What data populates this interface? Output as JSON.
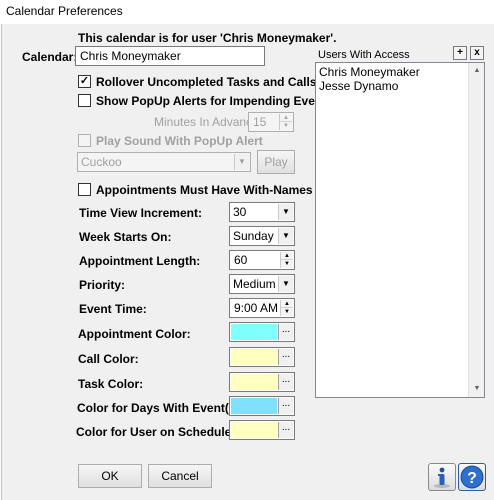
{
  "window": {
    "title": "Calendar Preferences"
  },
  "header": {
    "user_text": "This calendar is for user 'Chris Moneymaker'."
  },
  "calendar": {
    "label": "Calendar:",
    "value": "Chris Moneymaker"
  },
  "options": {
    "rollover": {
      "label": "Rollover Uncompleted Tasks and Calls",
      "checked": true
    },
    "popup": {
      "label": "Show PopUp Alerts for Impending Events",
      "checked": false
    },
    "minutes": {
      "label": "Minutes In Advance:",
      "value": "15"
    },
    "sound": {
      "label": "Play Sound With PopUp Alert",
      "checked": false
    },
    "sound_select": {
      "value": "Cuckoo"
    },
    "play_label": "Play",
    "with_names": {
      "label": "Appointments Must Have With-Names",
      "checked": false
    }
  },
  "settings": {
    "time_view": {
      "label": "Time View Increment:",
      "value": "30"
    },
    "week_start": {
      "label": "Week Starts On:",
      "value": "Sunday"
    },
    "appt_length": {
      "label": "Appointment Length:",
      "value": "60"
    },
    "priority": {
      "label": "Priority:",
      "value": "Medium"
    },
    "event_time": {
      "label": "Event Time:",
      "value": "9:00 AM"
    }
  },
  "colors": {
    "appointment": {
      "label": "Appointment Color:",
      "color": "#80ffff"
    },
    "call": {
      "label": "Call Color:",
      "color": "#ffffc0"
    },
    "task": {
      "label": "Task Color:",
      "color": "#ffffc0"
    },
    "days_event": {
      "label": "Color for Days With Event(s):",
      "color": "#80e0ff"
    },
    "user_sched": {
      "label": "Color for User on Scheduler:",
      "color": "#ffffc0"
    }
  },
  "access": {
    "header": "Users With Access",
    "add": "+",
    "remove": "x",
    "users": [
      "Chris Moneymaker",
      "Jesse Dynamo"
    ]
  },
  "buttons": {
    "ok": "OK",
    "cancel": "Cancel"
  },
  "icons": {
    "info": "info-icon",
    "help": "help-icon"
  },
  "dots": "..."
}
